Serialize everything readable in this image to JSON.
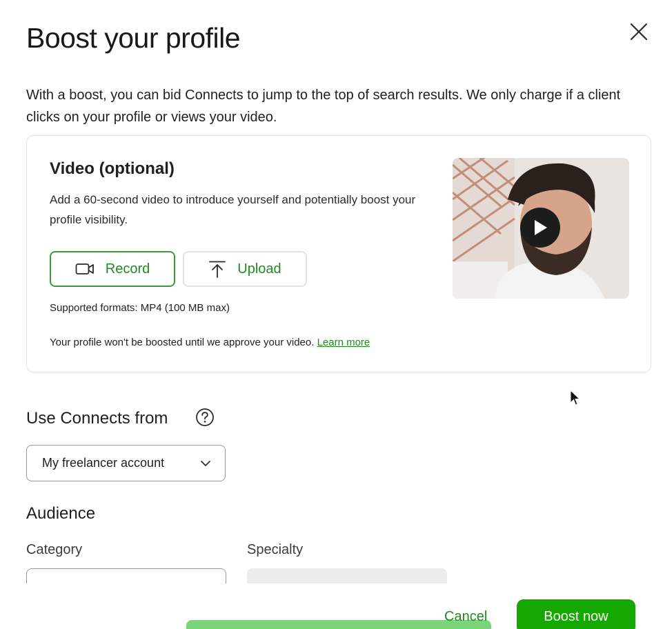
{
  "modal": {
    "title": "Boost your profile",
    "close_icon": "close-icon",
    "intro": "With a boost, you can bid Connects to jump to the top of search results. We only charge if a client clicks on your profile or views your video."
  },
  "video": {
    "title": "Video (optional)",
    "description": "Add a 60-second video to introduce yourself and potentially boost your profile visibility.",
    "record_label": "Record",
    "upload_label": "Upload",
    "formats": "Supported formats: MP4 (100 MB max)",
    "approve_note": "Your profile won't be boosted until we approve your video.",
    "learn_more": "Learn more"
  },
  "connects": {
    "label": "Use Connects from",
    "selected": "My freelancer account"
  },
  "audience": {
    "heading": "Audience",
    "category_label": "Category",
    "specialty_label": "Specialty"
  },
  "footer": {
    "cancel": "Cancel",
    "boost": "Boost now"
  },
  "colors": {
    "brand_green": "#14a800",
    "link_green": "#1f8a1f"
  }
}
